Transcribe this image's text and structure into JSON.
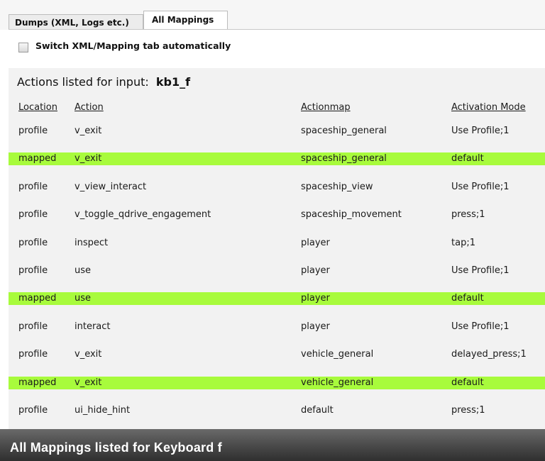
{
  "tabs": [
    {
      "label": "Dumps (XML, Logs etc.)",
      "active": false
    },
    {
      "label": "All Mappings",
      "active": true
    }
  ],
  "toolbar": {
    "checkbox_label": "Switch XML/Mapping tab automatically",
    "checked": false
  },
  "section": {
    "title_prefix": "Actions listed for input:",
    "input_key": "kb1_f"
  },
  "table": {
    "headers": {
      "location": "Location",
      "action": "Action",
      "actionmap": "Actionmap",
      "activation": "Activation Mode"
    },
    "rows": [
      {
        "location": "profile",
        "action": "v_exit",
        "actionmap": "spaceship_general",
        "activation": "Use Profile;1",
        "highlight": false
      },
      {
        "location": "mapped",
        "action": "v_exit",
        "actionmap": "spaceship_general",
        "activation": "default",
        "highlight": true
      },
      {
        "location": "profile",
        "action": "v_view_interact",
        "actionmap": "spaceship_view",
        "activation": "Use Profile;1",
        "highlight": false
      },
      {
        "location": "profile",
        "action": "v_toggle_qdrive_engagement",
        "actionmap": "spaceship_movement",
        "activation": "press;1",
        "highlight": false
      },
      {
        "location": "profile",
        "action": "inspect",
        "actionmap": "player",
        "activation": "tap;1",
        "highlight": false
      },
      {
        "location": "profile",
        "action": "use",
        "actionmap": "player",
        "activation": "Use Profile;1",
        "highlight": false
      },
      {
        "location": "mapped",
        "action": "use",
        "actionmap": "player",
        "activation": "default",
        "highlight": true
      },
      {
        "location": "profile",
        "action": "interact",
        "actionmap": "player",
        "activation": "Use Profile;1",
        "highlight": false
      },
      {
        "location": "profile",
        "action": "v_exit",
        "actionmap": "vehicle_general",
        "activation": "delayed_press;1",
        "highlight": false
      },
      {
        "location": "mapped",
        "action": "v_exit",
        "actionmap": "vehicle_general",
        "activation": "default",
        "highlight": true
      },
      {
        "location": "profile",
        "action": "ui_hide_hint",
        "actionmap": "default",
        "activation": "press;1",
        "highlight": false
      }
    ]
  },
  "footer": {
    "caption": "All Mappings listed for Keyboard f"
  },
  "colors": {
    "highlight": "#a8fb3c",
    "panel_background": "#f2f2f2",
    "footer_background": "#4e4e4e"
  }
}
